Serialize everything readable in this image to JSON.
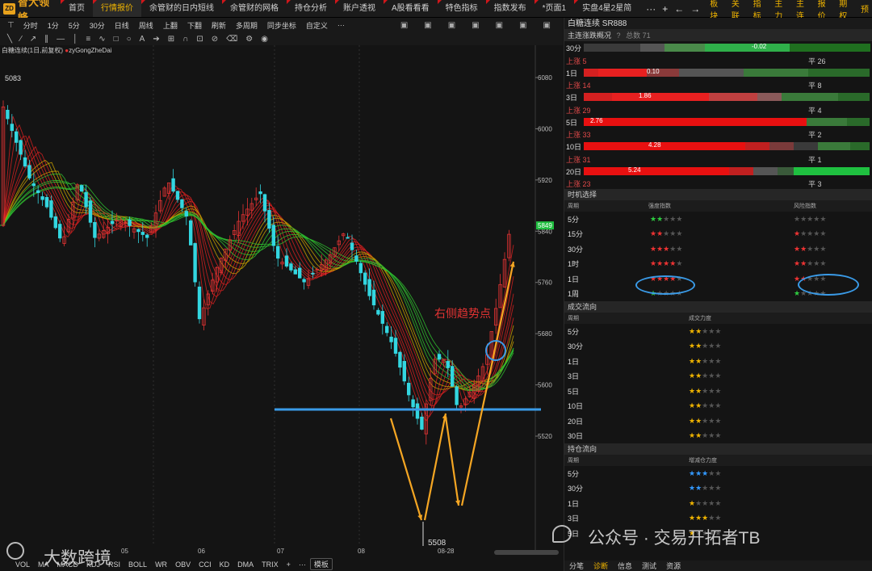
{
  "app": {
    "logo_text": "智大领峰",
    "logo_badge": "ZD"
  },
  "tabs": [
    "首页",
    "行情报价",
    "余管财的日内短线",
    "余管财的网格",
    "持仓分析",
    "账户透视",
    "A股看看看",
    "特色指标",
    "指数发布",
    "*页面1",
    "实盘4星2星简"
  ],
  "active_tab": "行情报价",
  "top_icons": {
    "more": "···",
    "add": "+",
    "back": "←",
    "forward": "→"
  },
  "right_menu": [
    "板块",
    "关联",
    "指标",
    "主力",
    "主连",
    "报价",
    "期权",
    "预"
  ],
  "toolbar1": [
    "分时",
    "1分",
    "5分",
    "30分",
    "日线",
    "周线",
    "上翻",
    "下翻",
    "刷新",
    "多周期",
    "同步坐标",
    "自定义",
    "···"
  ],
  "chart": {
    "legend_name": "白糖连续(1日,前复权)",
    "legend_indicator": "zyGongZheDai",
    "high_label": "5083",
    "low_label": "5508",
    "price_ticks": [
      "6080",
      "6000",
      "5920",
      "5840",
      "5760",
      "5680",
      "5600",
      "5520"
    ],
    "current_price": "5849",
    "time_labels": [
      "05",
      "06",
      "07",
      "08",
      "08-28"
    ],
    "annotation": "右侧趋势点"
  },
  "indicators": [
    "VOL",
    "MA",
    "MACD",
    "KDJ",
    "RSI",
    "BOLL",
    "WR",
    "OBV",
    "CCI",
    "KD",
    "DMA",
    "TRIX",
    "+",
    "···",
    "模板"
  ],
  "right_panel": {
    "title": "白糖连续 SR888",
    "mr_header": "主连涨跌概况",
    "mr_header_extra": "总数 71",
    "mr_rows": [
      {
        "period": "30分",
        "value": "-0.02",
        "up": "",
        "flat": ""
      },
      {
        "period": "1日",
        "value": "0.10",
        "up": "上涨 5",
        "flat": "平 26"
      },
      {
        "period": "3日",
        "value": "1.86",
        "up": "上涨 14",
        "flat": "平 8"
      },
      {
        "period": "5日",
        "value": "2.76",
        "up": "上涨 29",
        "flat": "平 4"
      },
      {
        "period": "10日",
        "value": "4.28",
        "up": "上涨 33",
        "flat": "平 2"
      },
      {
        "period": "20日",
        "value": "5.24",
        "up": "上涨 31",
        "flat": "平 1"
      },
      {
        "period": "",
        "value": "",
        "up": "上涨 23",
        "flat": "平 3"
      }
    ],
    "timing_header": "时机选择",
    "timing_cols": [
      "周期",
      "强度指数",
      "风险指数"
    ],
    "timing_rows": [
      "5分",
      "15分",
      "30分",
      "1时",
      "1日",
      "1周"
    ],
    "flow_header": "成交流向",
    "flow_cols": [
      "周期",
      "成交力度"
    ],
    "flow_rows": [
      "5分",
      "30分",
      "1日",
      "3日",
      "5日",
      "10日",
      "20日",
      "30日"
    ],
    "pos_header": "持仓流向",
    "pos_cols": [
      "周期",
      "增减仓力度"
    ],
    "pos_rows": [
      "5分",
      "30分",
      "1日",
      "3日",
      "5日"
    ],
    "bottom_tabs": [
      "分笔",
      "诊断",
      "信息",
      "测试",
      "资源"
    ],
    "active_bottom_tab": "诊断"
  },
  "watermark": {
    "left": "大数跨境",
    "right": "公众号 · 交易开拓者TB"
  },
  "colors": {
    "accent": "#f0b400",
    "up": "#e33333",
    "down": "#33d6e0",
    "trend_line": "#3a9be8"
  }
}
